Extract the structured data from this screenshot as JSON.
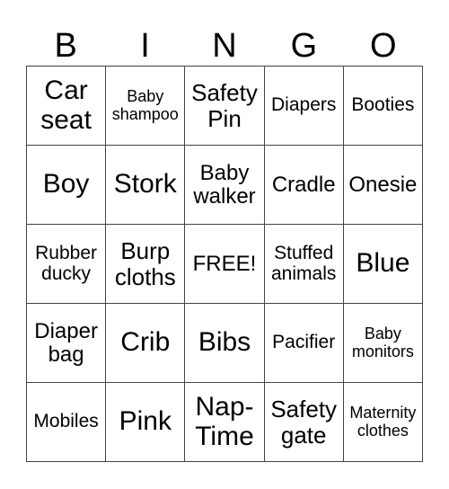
{
  "header": {
    "letters": [
      "B",
      "I",
      "N",
      "G",
      "O"
    ]
  },
  "board": {
    "rows": [
      [
        {
          "text": "Car seat",
          "size": "l"
        },
        {
          "text": "Baby shampoo",
          "size": "xs"
        },
        {
          "text": "Safety Pin",
          "size": "m"
        },
        {
          "text": "Diapers",
          "size": "s"
        },
        {
          "text": "Booties",
          "size": "s"
        }
      ],
      [
        {
          "text": "Boy",
          "size": "l"
        },
        {
          "text": "Stork",
          "size": "l"
        },
        {
          "text": "Baby walker",
          "size": "ms"
        },
        {
          "text": "Cradle",
          "size": "ms"
        },
        {
          "text": "Onesie",
          "size": "ms"
        }
      ],
      [
        {
          "text": "Rubber ducky",
          "size": "s"
        },
        {
          "text": "Burp cloths",
          "size": "m"
        },
        {
          "text": "FREE!",
          "size": "ms"
        },
        {
          "text": "Stuffed animals",
          "size": "s"
        },
        {
          "text": "Blue",
          "size": "l"
        }
      ],
      [
        {
          "text": "Diaper bag",
          "size": "ms"
        },
        {
          "text": "Crib",
          "size": "l"
        },
        {
          "text": "Bibs",
          "size": "l"
        },
        {
          "text": "Pacifier",
          "size": "s"
        },
        {
          "text": "Baby monitors",
          "size": "xs"
        }
      ],
      [
        {
          "text": "Mobiles",
          "size": "s"
        },
        {
          "text": "Pink",
          "size": "l"
        },
        {
          "text": "Nap-Time",
          "size": "l"
        },
        {
          "text": "Safety gate",
          "size": "m"
        },
        {
          "text": "Maternity clothes",
          "size": "xs"
        }
      ]
    ]
  }
}
